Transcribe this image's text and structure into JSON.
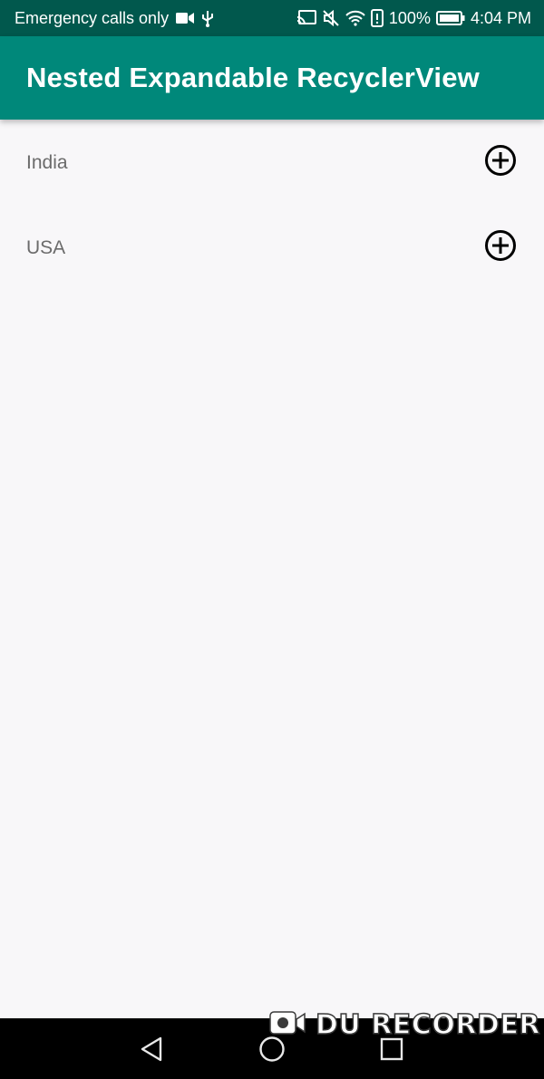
{
  "status_bar": {
    "carrier_text": "Emergency calls only",
    "battery_percent": "100%",
    "time": "4:04 PM",
    "icons": [
      "video-camera-icon",
      "usb-icon",
      "cast-icon",
      "mute-icon",
      "wifi-icon",
      "alert-icon",
      "battery-icon"
    ]
  },
  "app_bar": {
    "title": "Nested Expandable RecyclerView",
    "color": "#00887a"
  },
  "list": {
    "items": [
      {
        "label": "India",
        "icon": "add-circle-icon"
      },
      {
        "label": "USA",
        "icon": "add-circle-icon"
      }
    ]
  },
  "nav_bar": {
    "buttons": [
      "back-icon",
      "home-icon",
      "recents-icon"
    ]
  },
  "watermark": {
    "text": "DU RECORDER"
  }
}
